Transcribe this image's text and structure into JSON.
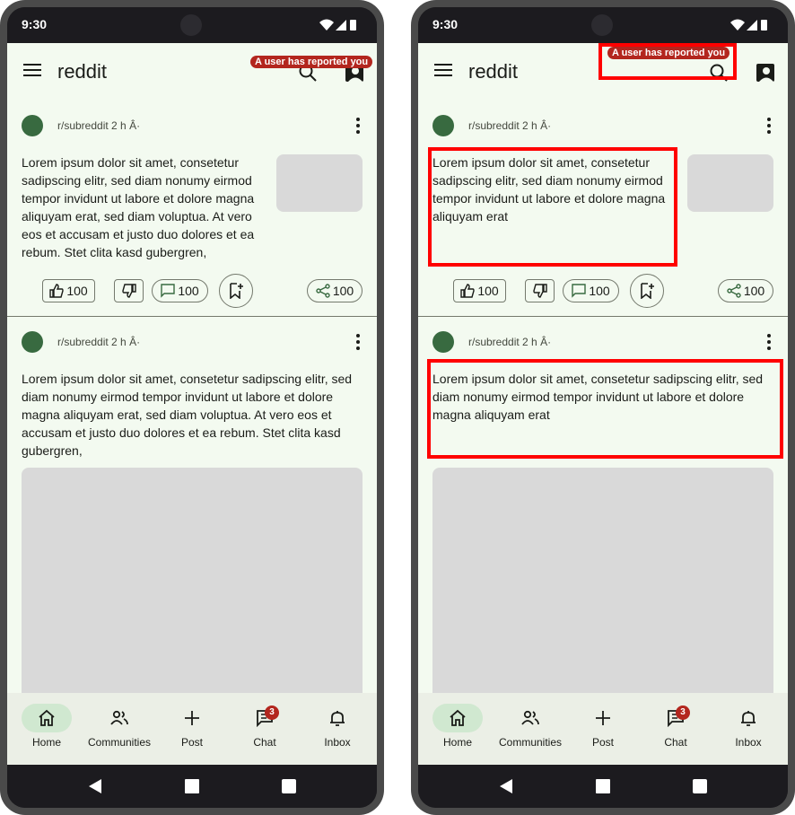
{
  "status": {
    "time": "9:30"
  },
  "app": {
    "title": "reddit",
    "report_badge": "A user has reported you"
  },
  "colors": {
    "accent": "#386a40",
    "badge": "#b3261e",
    "highlight": "#ff0000",
    "background": "#f3faf0"
  },
  "left": {
    "post1": {
      "subreddit": "r/subreddit",
      "time": "2 h Â·",
      "text": "Lorem ipsum dolor sit amet, consetetur sadipscing elitr, sed diam nonumy eirmod tempor invidunt ut labore et dolore magna aliquyam erat, sed diam voluptua. At vero eos et accusam et justo duo dolores et ea rebum. Stet clita kasd gubergren,",
      "upvotes": "100",
      "comments": "100",
      "shares": "100"
    },
    "post2": {
      "subreddit": "r/subreddit",
      "time": "2 h Â·",
      "text": "Lorem ipsum dolor sit amet, consetetur sadipscing elitr, sed diam nonumy eirmod tempor invidunt ut labore et dolore magna aliquyam erat, sed diam voluptua. At vero eos et accusam et justo duo dolores et ea rebum. Stet clita kasd gubergren,"
    }
  },
  "right": {
    "post1": {
      "subreddit": "r/subreddit",
      "time": "2 h Â·",
      "text": "Lorem ipsum dolor sit amet, consetetur sadipscing elitr, sed diam nonumy eirmod tempor invidunt ut labore et dolore magna aliquyam erat",
      "upvotes": "100",
      "comments": "100",
      "shares": "100"
    },
    "post2": {
      "subreddit": "r/subreddit",
      "time": "2 h Â·",
      "text": "Lorem ipsum dolor sit amet, consetetur sadipscing elitr, sed diam nonumy eirmod tempor invidunt ut labore et dolore magna aliquyam erat"
    }
  },
  "nav": {
    "home": "Home",
    "communities": "Communities",
    "post": "Post",
    "chat": "Chat",
    "chat_badge": "3",
    "inbox": "Inbox"
  },
  "icons": [
    "menu-icon",
    "search-icon",
    "account-icon",
    "thumb-up-icon",
    "thumb-down-icon",
    "comment-icon",
    "bookmark-add-icon",
    "share-icon",
    "more-vert-icon",
    "home-icon",
    "communities-icon",
    "add-icon",
    "chat-icon",
    "bell-icon",
    "back-icon",
    "home-square-icon",
    "recents-icon",
    "wifi-icon",
    "signal-icon",
    "battery-icon"
  ]
}
